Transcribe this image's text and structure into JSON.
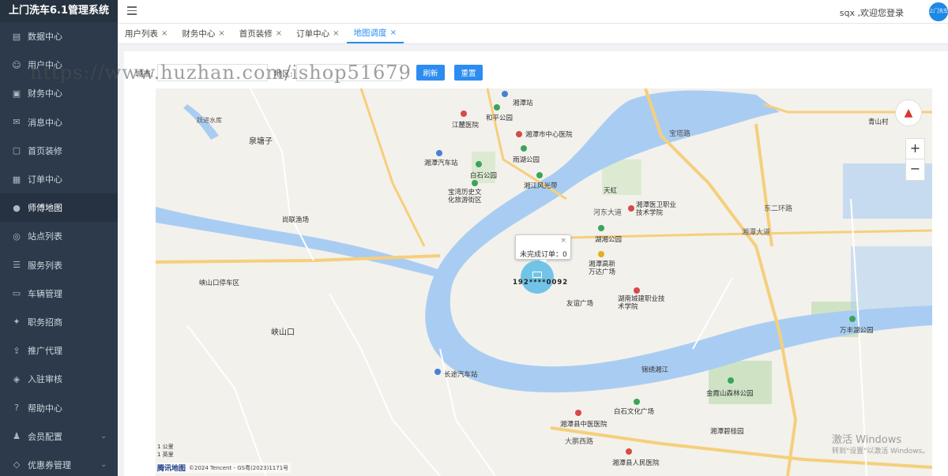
{
  "app": {
    "title": "上门洗车6.1管理系统"
  },
  "sidebar": {
    "items": [
      {
        "label": "数据中心",
        "icon": "chart-icon"
      },
      {
        "label": "用户中心",
        "icon": "user-icon"
      },
      {
        "label": "财务中心",
        "icon": "wallet-icon"
      },
      {
        "label": "消息中心",
        "icon": "message-icon"
      },
      {
        "label": "首页装修",
        "icon": "box-icon"
      },
      {
        "label": "订单中心",
        "icon": "order-icon"
      },
      {
        "label": "师傅地图",
        "icon": "map-pin-icon",
        "active": true
      },
      {
        "label": "站点列表",
        "icon": "station-icon"
      },
      {
        "label": "服务列表",
        "icon": "list-icon"
      },
      {
        "label": "车辆管理",
        "icon": "car-icon"
      },
      {
        "label": "职务招商",
        "icon": "recruit-icon"
      },
      {
        "label": "推广代理",
        "icon": "promote-icon"
      },
      {
        "label": "入驻审核",
        "icon": "audit-icon"
      },
      {
        "label": "帮助中心",
        "icon": "help-icon"
      },
      {
        "label": "会员配置",
        "icon": "member-icon",
        "has_children": true
      },
      {
        "label": "优惠券管理",
        "icon": "coupon-icon",
        "has_children": true
      }
    ]
  },
  "header": {
    "welcome": "sqx ,欢迎您登录",
    "avatar_text": "上门洗车"
  },
  "tabs": [
    {
      "label": "用户列表"
    },
    {
      "label": "财务中心"
    },
    {
      "label": "首页装修"
    },
    {
      "label": "订单中心"
    },
    {
      "label": "地图调度",
      "active": true
    }
  ],
  "search": {
    "label_1": "城市:",
    "label_2": "地区:",
    "refresh_label": "刷新",
    "reset_label": "重置"
  },
  "watermark": "https://www.huzhan.com/ishop51679",
  "map": {
    "popup_text": "未完成订单：0",
    "popup_close": "×",
    "marker_label": "192****0092",
    "zoom_in": "+",
    "zoom_out": "−",
    "scale_1": "1 公里",
    "scale_2": "1 英里",
    "brand": "腾讯地图",
    "copyright": "©2024 Tencent - GS粤(2023)1171号",
    "places": [
      "湘潭站",
      "和平公园",
      "江麓医院",
      "湘潭市中心医院",
      "湘潭汽车站",
      "白石公园",
      "雨湖公园",
      "湘江风光带",
      "宝湾历史文化旅游街区",
      "天虹",
      "湘潭医卫职业技术学院",
      "湖湘公园",
      "湘潭高新万达广场",
      "友谊广场",
      "湖南城建职业技术学院",
      "长途汽车站",
      "锦绣湘江",
      "白石文化广场",
      "金霞山森林公园",
      "万丰湖公园",
      "湘潭碧桂园",
      "湘潭县中医医院",
      "湘潭县人民医院",
      "泉塘子",
      "峡山口",
      "峡山口停车区",
      "尚联渔场",
      "青山村",
      "跃进水库",
      "大鹏西路",
      "湘潭大道",
      "东二环路",
      "河东大道",
      "宝塔路"
    ]
  },
  "windows_notice": {
    "title": "激活 Windows",
    "subtitle": "转到\"设置\"以激活 Windows。"
  }
}
